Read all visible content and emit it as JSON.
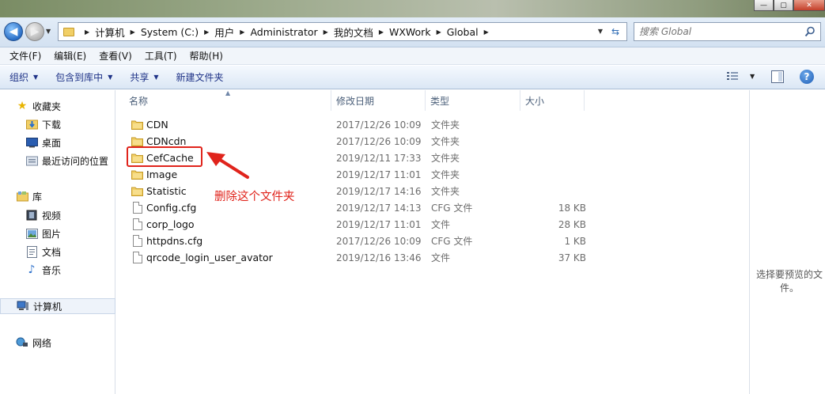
{
  "window": {
    "minimize_glyph": "—",
    "maximize_glyph": "▢",
    "close_glyph": "✕"
  },
  "address": {
    "back_glyph": "◀",
    "forward_glyph": "▶",
    "breadcrumb": [
      "计算机",
      "System (C:)",
      "用户",
      "Administrator",
      "我的文档",
      "WXWork",
      "Global"
    ],
    "refresh_glyph": "⇆",
    "search_placeholder": "搜索 Global"
  },
  "menu": [
    "文件(F)",
    "编辑(E)",
    "查看(V)",
    "工具(T)",
    "帮助(H)"
  ],
  "commands": {
    "organize": "组织",
    "include_in_library": "包含到库中",
    "share": "共享",
    "new_folder": "新建文件夹",
    "help_glyph": "?"
  },
  "nav": {
    "favorites": "收藏夹",
    "downloads": "下载",
    "desktop": "桌面",
    "recent": "最近访问的位置",
    "libraries": "库",
    "videos": "视频",
    "pictures": "图片",
    "documents": "文档",
    "music": "音乐",
    "computer": "计算机",
    "network": "网络"
  },
  "columns": {
    "name": "名称",
    "date": "修改日期",
    "type": "类型",
    "size": "大小"
  },
  "files": [
    {
      "name": "CDN",
      "date": "2017/12/26 10:09",
      "type": "文件夹",
      "size": "",
      "kind": "folder"
    },
    {
      "name": "CDNcdn",
      "date": "2017/12/26 10:09",
      "type": "文件夹",
      "size": "",
      "kind": "folder"
    },
    {
      "name": "CefCache",
      "date": "2019/12/11 17:33",
      "type": "文件夹",
      "size": "",
      "kind": "folder"
    },
    {
      "name": "Image",
      "date": "2019/12/17 11:01",
      "type": "文件夹",
      "size": "",
      "kind": "folder"
    },
    {
      "name": "Statistic",
      "date": "2019/12/17 14:16",
      "type": "文件夹",
      "size": "",
      "kind": "folder"
    },
    {
      "name": "Config.cfg",
      "date": "2019/12/17 14:13",
      "type": "CFG 文件",
      "size": "18 KB",
      "kind": "file"
    },
    {
      "name": "corp_logo",
      "date": "2019/12/17 11:01",
      "type": "文件",
      "size": "28 KB",
      "kind": "file"
    },
    {
      "name": "httpdns.cfg",
      "date": "2017/12/26 10:09",
      "type": "CFG 文件",
      "size": "1 KB",
      "kind": "file"
    },
    {
      "name": "qrcode_login_user_avator",
      "date": "2019/12/16 13:46",
      "type": "文件",
      "size": "37 KB",
      "kind": "file"
    }
  ],
  "annotation": {
    "text": "删除这个文件夹",
    "color": "#e0241c"
  },
  "preview": {
    "message": "选择要预览的文件。"
  }
}
